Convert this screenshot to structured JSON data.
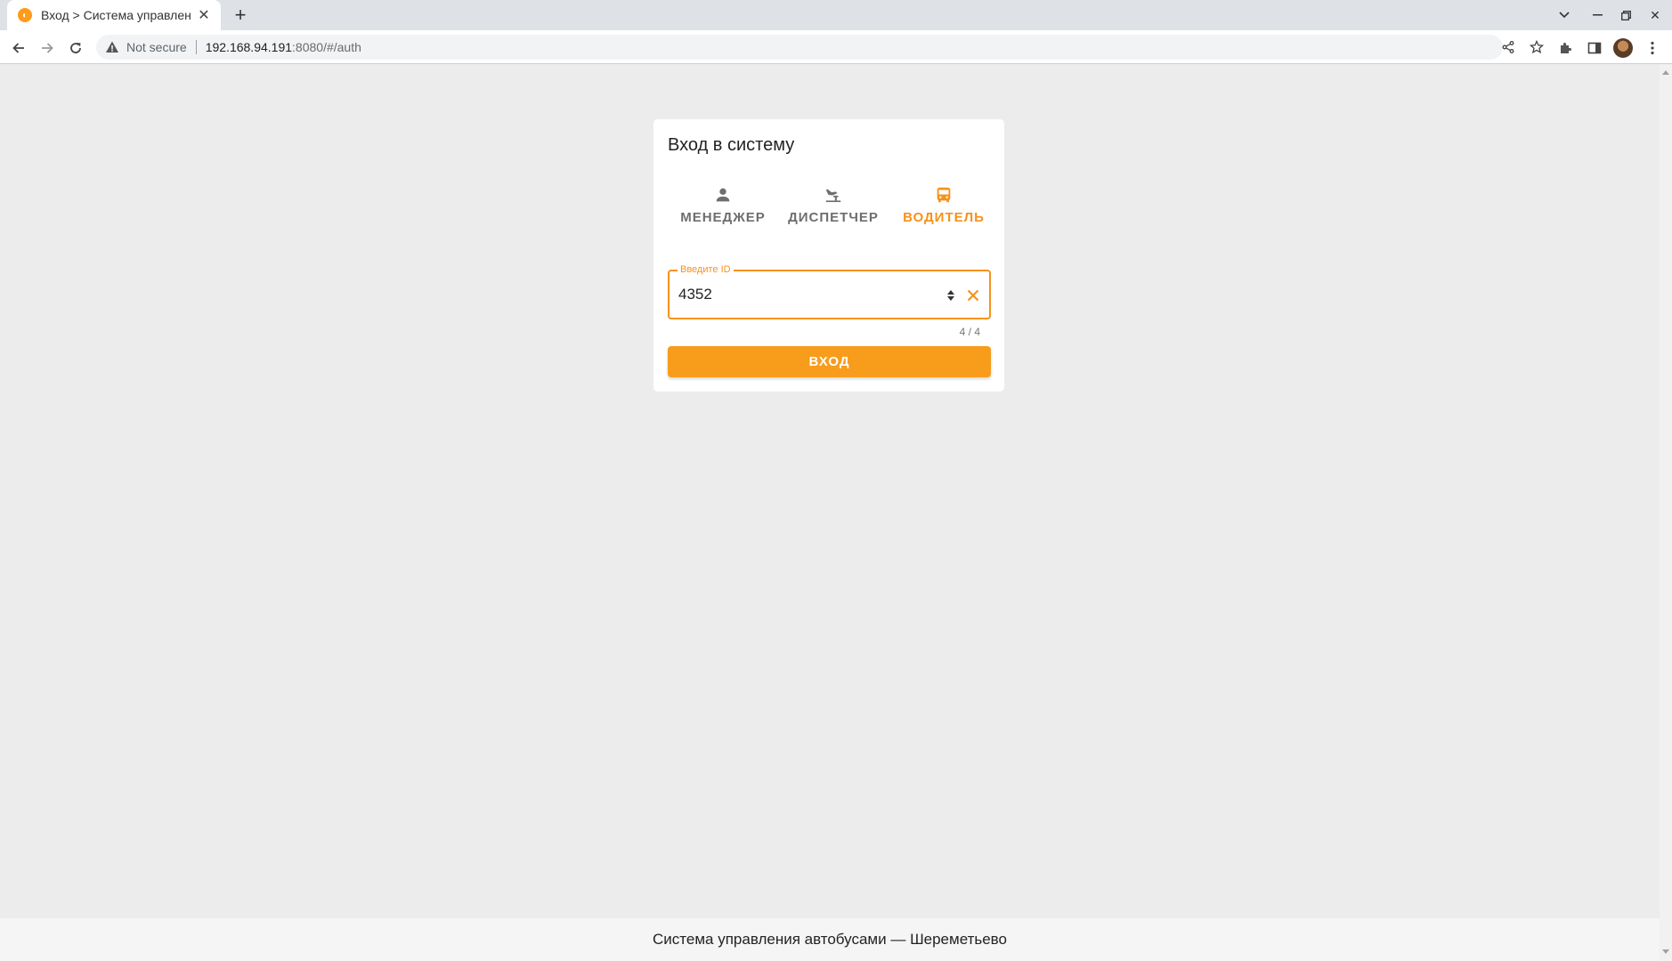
{
  "browser": {
    "tab_title": "Вход > Система управления",
    "url_not_secure": "Not secure",
    "url_host": "192.168.94.191",
    "url_rest": ":8080/#/auth"
  },
  "login": {
    "title": "Вход в систему",
    "roles": [
      {
        "label": "МЕНЕДЖЕР",
        "icon": "person-icon",
        "active": false
      },
      {
        "label": "ДИСПЕТЧЕР",
        "icon": "flight-land-icon",
        "active": false
      },
      {
        "label": "ВОДИТЕЛЬ",
        "icon": "bus-icon",
        "active": true
      }
    ],
    "id_field": {
      "label": "Введите ID",
      "value": "4352",
      "counter": "4 / 4"
    },
    "submit_label": "ВХОД"
  },
  "footer": {
    "text": "Система управления автобусами — Шереметьево"
  },
  "colors": {
    "accent": "#f7921a",
    "background": "#ececec",
    "card": "#ffffff"
  }
}
